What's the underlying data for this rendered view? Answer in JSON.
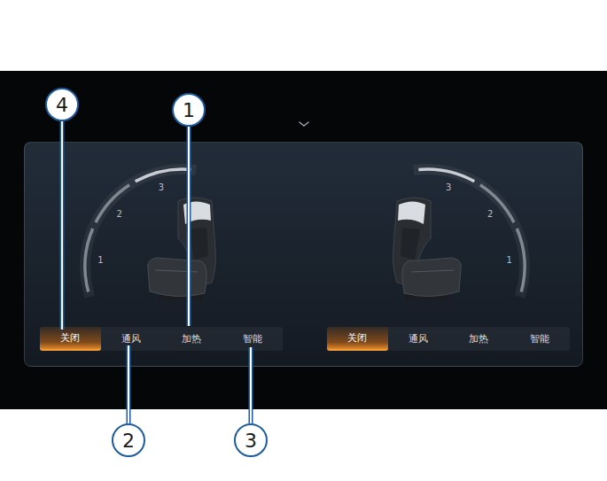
{
  "callouts": [
    {
      "number": "4"
    },
    {
      "number": "1"
    },
    {
      "number": "2"
    },
    {
      "number": "3"
    }
  ],
  "seats": [
    {
      "scale": [
        "1",
        "2",
        "3"
      ],
      "buttons": [
        {
          "label": "关闭",
          "selected": true
        },
        {
          "label": "通风",
          "selected": false
        },
        {
          "label": "加热",
          "selected": false
        },
        {
          "label": "智能",
          "selected": false
        }
      ]
    },
    {
      "scale": [
        "1",
        "2",
        "3"
      ],
      "buttons": [
        {
          "label": "关闭",
          "selected": true
        },
        {
          "label": "通风",
          "selected": false
        },
        {
          "label": "加热",
          "selected": false
        },
        {
          "label": "智能",
          "selected": false
        }
      ]
    }
  ]
}
